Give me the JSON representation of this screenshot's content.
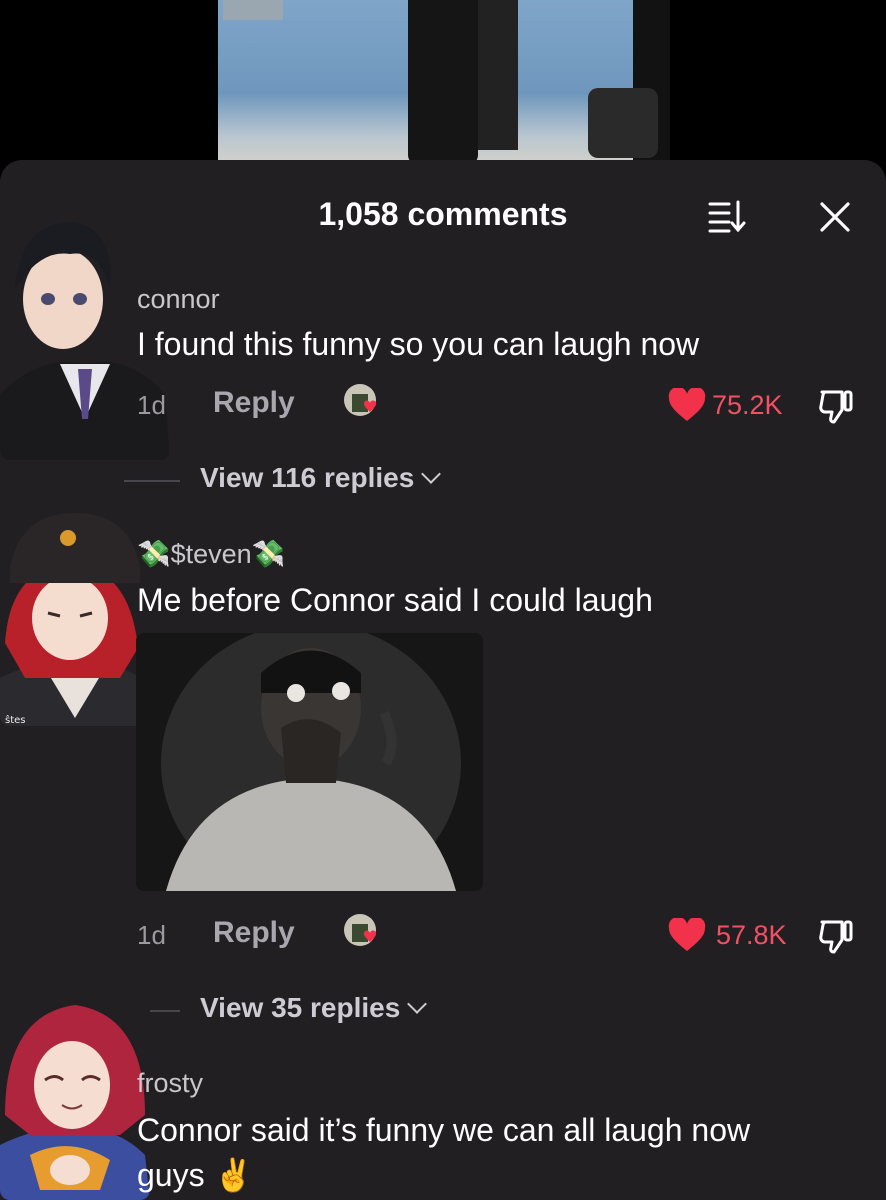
{
  "header": {
    "comments_count": "1,058 comments",
    "sort_icon": "sort-icon",
    "close_icon": "close-icon"
  },
  "comments": [
    {
      "username": "connor",
      "text": "I found this funny so you can laugh now",
      "time": "1d",
      "reply_label": "Reply",
      "likes": "75.2K",
      "view_replies": "View 116 replies"
    },
    {
      "username": "💸$teven💸",
      "text": "Me before Connor said I could laugh",
      "time": "1d",
      "reply_label": "Reply",
      "likes": "57.8K",
      "view_replies": "View 35 replies"
    },
    {
      "username": "frosty",
      "text_line1": "Connor said it’s funny we can all laugh now",
      "text_line2": "guys ✌️"
    }
  ],
  "colors": {
    "sheet_bg": "#221f23",
    "like_red": "#f25063",
    "muted_text": "#9c99a0"
  }
}
